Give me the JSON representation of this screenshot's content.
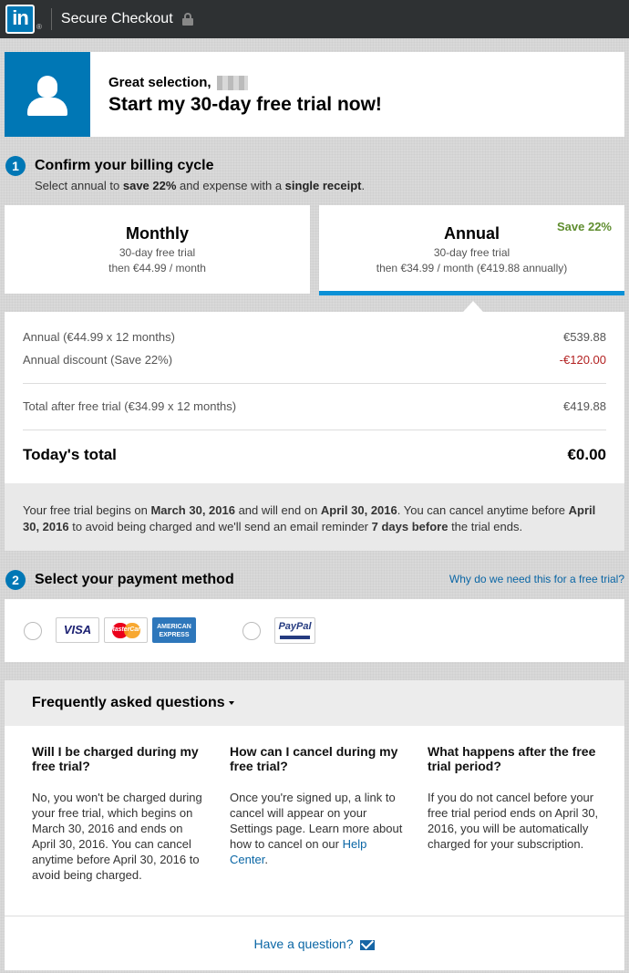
{
  "topbar": {
    "logo_text": "in",
    "logo_mark": "®",
    "title": "Secure Checkout",
    "lock_icon": "lock-icon"
  },
  "hero": {
    "greeting": "Great selection,",
    "headline": "Start my 30-day free trial now!",
    "avatar_icon": "person-icon",
    "brand_color": "#0077b5"
  },
  "billing": {
    "step_number": "1",
    "title": "Confirm your billing cycle",
    "subtitle_pre": "Select annual to ",
    "subtitle_b1": "save 22%",
    "subtitle_mid": " and expense with a ",
    "subtitle_b2": "single receipt",
    "subtitle_post": ".",
    "plans": [
      {
        "name": "Monthly",
        "line1": "30-day free trial",
        "line2": "then €44.99 / month",
        "selected": false
      },
      {
        "name": "Annual",
        "line1": "30-day free trial",
        "line2": "then €34.99 / month (€419.88 annually)",
        "badge": "Save 22%",
        "selected": true
      }
    ]
  },
  "summary": {
    "rows": [
      {
        "label": "Annual (€44.99 x 12 months)",
        "value": "€539.88"
      },
      {
        "label": "Annual discount (Save 22%)",
        "value": "-€120.00"
      },
      {
        "label": "Total after free trial (€34.99 x 12 months)",
        "value": "€419.88"
      }
    ],
    "total_label": "Today's total",
    "total_value": "€0.00"
  },
  "notice": {
    "t1": "Your free trial begins on ",
    "b1": "March 30, 2016",
    "t2": " and will end on ",
    "b2": "April 30, 2016",
    "t3": ". You can cancel anytime before ",
    "b3": "April 30, 2016",
    "t4": " to avoid being charged and we'll send an email reminder ",
    "b4": "7 days before",
    "t5": " the trial ends."
  },
  "payment": {
    "step_number": "2",
    "title": "Select your payment method",
    "why_link": "Why do we need this for a free trial?",
    "cards": {
      "visa": "VISA",
      "mastercard": "MasterCard",
      "amex_1": "AMERICAN",
      "amex_2": "EXPRESS",
      "paypal": "PayPal"
    }
  },
  "faq": {
    "title": "Frequently asked questions",
    "items": [
      {
        "q": "Will I be charged during my free trial?",
        "a": "No, you won't be charged during your free trial, which begins on March 30, 2016 and ends on April 30, 2016. You can cancel anytime before April 30, 2016 to avoid being charged."
      },
      {
        "q": "How can I cancel during my free trial?",
        "a": "Once you're signed up, a link to cancel will appear on your Settings page. Learn more about how to cancel on our ",
        "link": "Help Center",
        "a_end": "."
      },
      {
        "q": "What happens after the free trial period?",
        "a": "If you do not cancel before your free trial period ends on April 30, 2016, you will be automatically charged for your subscription."
      }
    ],
    "question_link": "Have a question?"
  }
}
